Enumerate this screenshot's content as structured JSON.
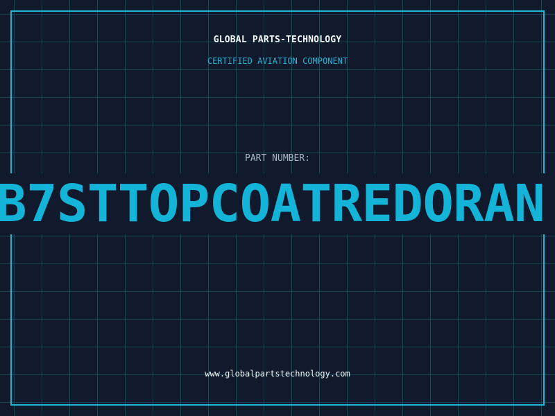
{
  "header": {
    "title": "GLOBAL PARTS-TECHNOLOGY",
    "subtitle": "CERTIFIED AVIATION COMPONENT"
  },
  "part": {
    "label": "PART NUMBER:",
    "number": "B7STTOPCOATREDORAN"
  },
  "footer": {
    "url": "www.globalpartstechnology.com"
  },
  "colors": {
    "background": "#111a2c",
    "grid": "#1d4655",
    "accent": "#1fb6d6",
    "text": "#f2f6f9",
    "muted_text": "#aab6c6"
  }
}
